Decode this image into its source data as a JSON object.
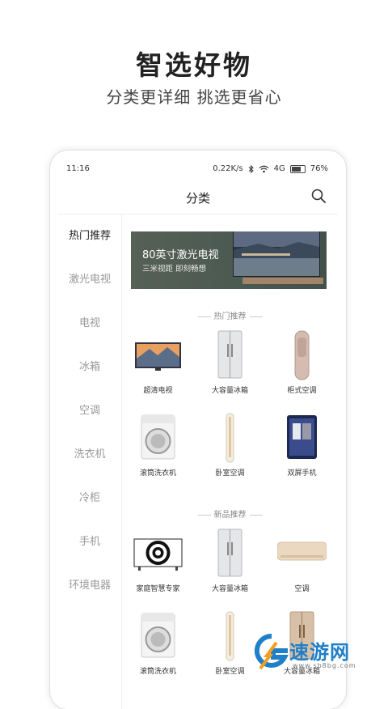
{
  "promo": {
    "title": "智选好物",
    "subtitle": "分类更详细 挑选更省心"
  },
  "status_bar": {
    "time": "11:16",
    "network_speed": "0.22K/s",
    "network_type": "4G",
    "battery": "76%",
    "battery_level": 0.76,
    "icons": [
      "bluetooth-icon",
      "wifi-icon",
      "battery-icon"
    ]
  },
  "header": {
    "title": "分类",
    "search_icon": "search-icon"
  },
  "sidebar": {
    "items": [
      {
        "label": "热门推荐",
        "active": true
      },
      {
        "label": "激光电视",
        "active": false
      },
      {
        "label": "电视",
        "active": false
      },
      {
        "label": "冰箱",
        "active": false
      },
      {
        "label": "空调",
        "active": false
      },
      {
        "label": "洗衣机",
        "active": false
      },
      {
        "label": "冷柜",
        "active": false
      },
      {
        "label": "手机",
        "active": false
      },
      {
        "label": "环境电器",
        "active": false
      }
    ]
  },
  "banner": {
    "title": "80英寸激光电视",
    "subtitle": "三米视距 即刻畅想"
  },
  "sections": [
    {
      "title": "热门推荐",
      "products": [
        {
          "label": "超清电视"
        },
        {
          "label": "大容量冰箱"
        },
        {
          "label": "柜式空调"
        },
        {
          "label": "滚筒洗衣机"
        },
        {
          "label": "卧室空调"
        },
        {
          "label": "双屏手机"
        }
      ]
    },
    {
      "title": "新品推荐",
      "products": [
        {
          "label": "家庭智慧专家"
        },
        {
          "label": "大容量冰箱"
        },
        {
          "label": "空调"
        },
        {
          "label": "滚筒洗衣机"
        },
        {
          "label": "卧室空调"
        },
        {
          "label": "大容量冰箱"
        }
      ]
    }
  ],
  "watermark": {
    "text": "速游网",
    "url": "www.sb8bg.com"
  },
  "colors": {
    "accent_text": "#222222",
    "muted_text": "#999999",
    "watermark_blue": "#1f7fc9"
  }
}
